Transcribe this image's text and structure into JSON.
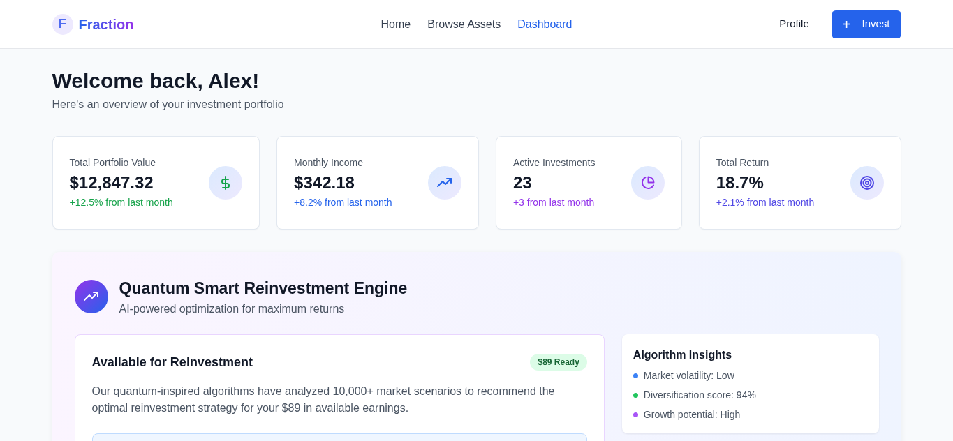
{
  "brand": {
    "logo_letter": "F",
    "name": "Fraction"
  },
  "nav": [
    {
      "label": "Home",
      "selected": false
    },
    {
      "label": "Browse Assets",
      "selected": false
    },
    {
      "label": "Dashboard",
      "selected": true
    }
  ],
  "actions": {
    "profile": "Profile",
    "invest": {
      "icon": "+",
      "label": "Invest"
    }
  },
  "welcome": {
    "title": "Welcome back, Alex!",
    "subtitle": "Here's an overview of your investment portfolio"
  },
  "stats": [
    {
      "label": "Total Portfolio Value",
      "value": "$12,847.32",
      "change": "+12.5% from last month",
      "color": "#16a34a",
      "kind": "dollar"
    },
    {
      "label": "Monthly Income",
      "value": "$342.18",
      "change": "+8.2% from last month",
      "color": "#2563eb",
      "kind": "trend"
    },
    {
      "label": "Active Investments",
      "value": "23",
      "change": "+3 from last month",
      "color": "#9333ea",
      "kind": "pie"
    },
    {
      "label": "Total Return",
      "value": "18.7%",
      "change": "+2.1% from last month",
      "color": "#4f46e5",
      "kind": "target"
    }
  ],
  "engine": {
    "title": "Quantum Smart Reinvestment Engine",
    "subtitle": "AI-powered optimization for maximum returns",
    "available": {
      "title": "Available for Reinvestment",
      "badge": "$89 Ready",
      "text": "Our quantum-inspired algorithms have analyzed 10,000+ market scenarios to recommend the optimal reinvestment strategy for your $89 in available earnings."
    },
    "insights": {
      "title": "Algorithm Insights",
      "items": [
        {
          "text": "Market volatility: Low",
          "color": "#3b82f6"
        },
        {
          "text": "Diversification score: 94%",
          "color": "#22c55e"
        },
        {
          "text": "Growth potential: High",
          "color": "#a855f7"
        }
      ]
    }
  }
}
